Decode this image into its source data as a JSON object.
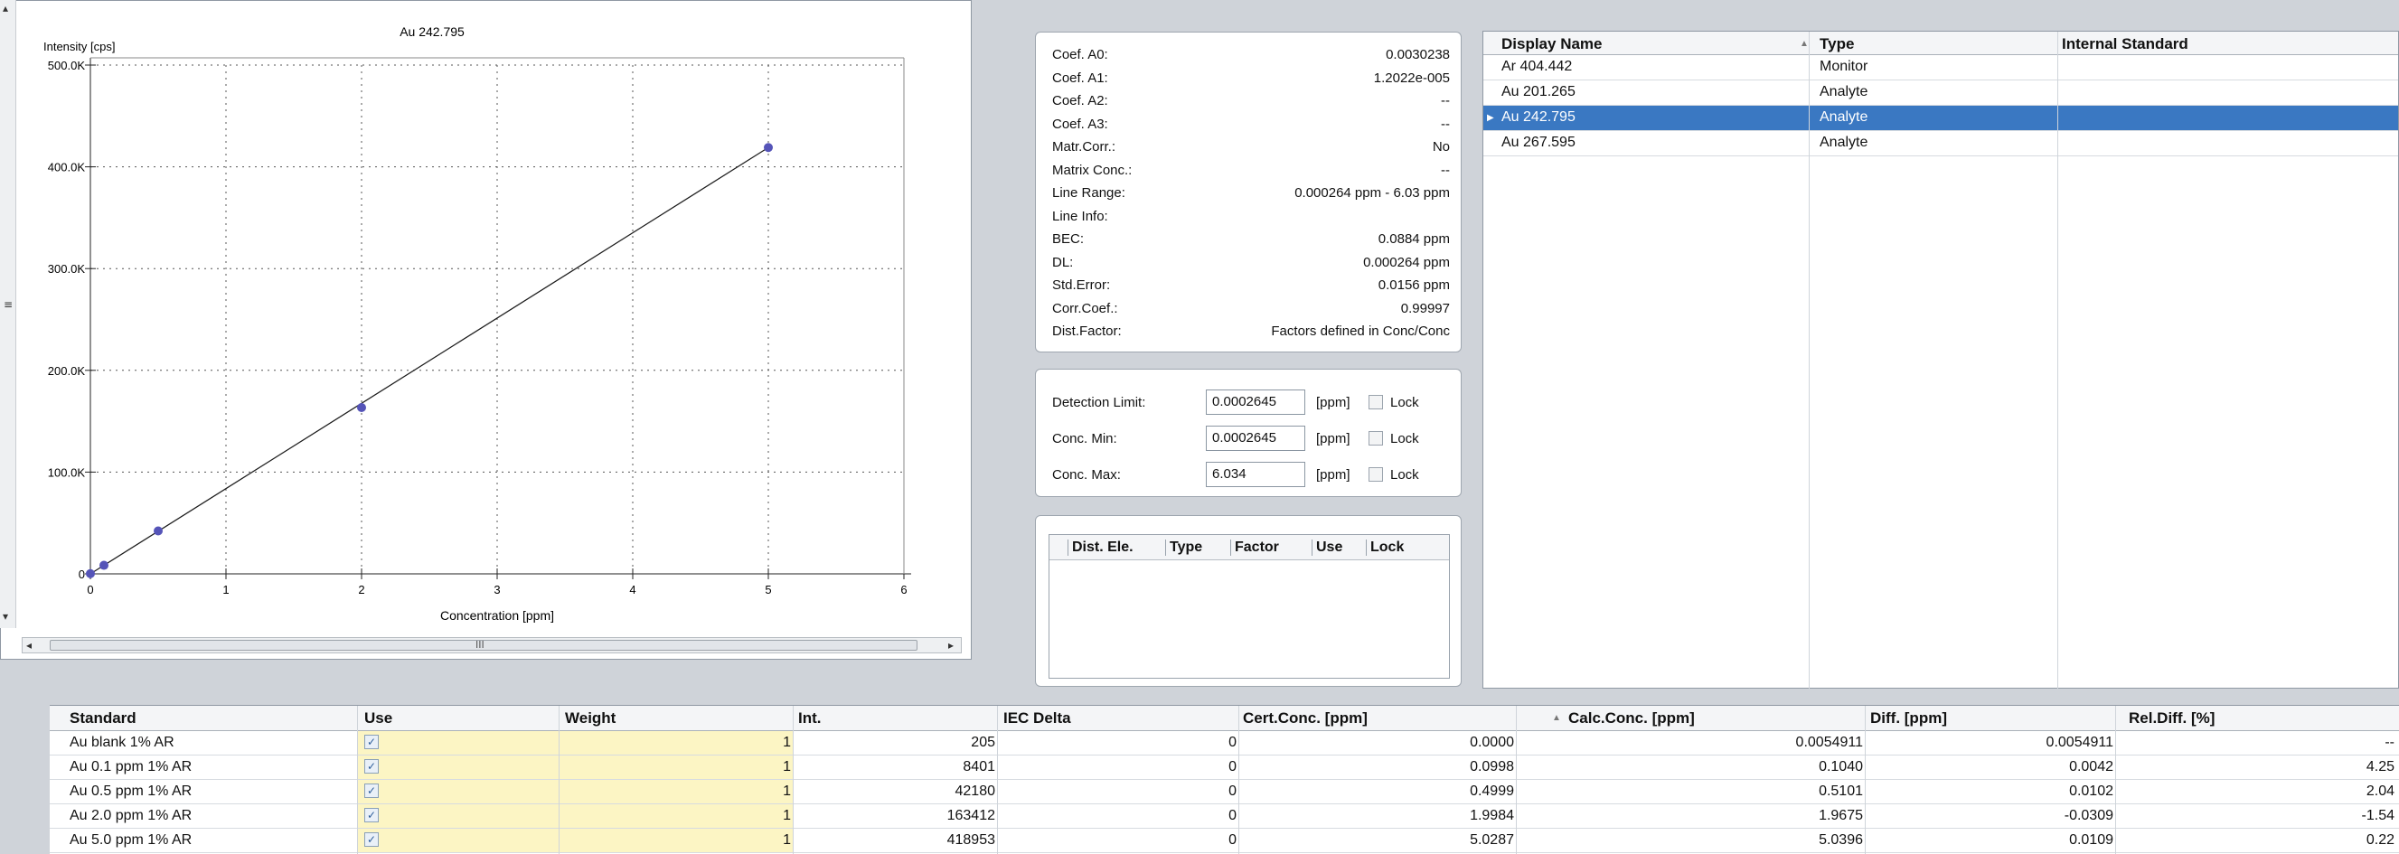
{
  "chart": {
    "title": "Au 242.795",
    "ylabel": "Intensity [cps]",
    "xlabel": "Concentration [ppm]",
    "scroll_label": "III"
  },
  "chart_data": {
    "type": "scatter",
    "title": "Au 242.795",
    "xlabel": "Concentration [ppm]",
    "ylabel": "Intensity [cps]",
    "xlim": [
      0,
      6
    ],
    "ylim": [
      0,
      500000
    ],
    "x_ticks": [
      "0",
      "1",
      "2",
      "3",
      "4",
      "5",
      "6"
    ],
    "y_ticks": [
      "0",
      "100.0K",
      "200.0K",
      "300.0K",
      "400.0K",
      "500.0K"
    ],
    "grid": true,
    "series": [
      {
        "x": [
          0,
          0.1,
          0.5,
          2.0,
          5.0
        ],
        "y": [
          205,
          8401,
          42180,
          163412,
          418953
        ]
      }
    ],
    "fit_line": {
      "x": [
        0,
        5.0
      ],
      "y": [
        0,
        418953
      ]
    }
  },
  "coef": [
    {
      "k": "Coef. A0:",
      "v": "0.0030238"
    },
    {
      "k": "Coef. A1:",
      "v": "1.2022e-005"
    },
    {
      "k": "Coef. A2:",
      "v": "--"
    },
    {
      "k": "Coef. A3:",
      "v": "--"
    },
    {
      "k": "Matr.Corr.:",
      "v": "No"
    },
    {
      "k": "Matrix Conc.:",
      "v": "--"
    },
    {
      "k": "Line Range:",
      "v": "0.000264 ppm - 6.03 ppm"
    },
    {
      "k": "Line Info:",
      "v": ""
    },
    {
      "k": "BEC:",
      "v": "0.0884 ppm"
    },
    {
      "k": "DL:",
      "v": "0.000264 ppm"
    },
    {
      "k": "Std.Error:",
      "v": "0.0156 ppm"
    },
    {
      "k": "Corr.Coef.:",
      "v": "0.99997"
    },
    {
      "k": "Dist.Factor:",
      "v": "Factors defined in Conc/Conc"
    }
  ],
  "limits": [
    {
      "k": "Detection Limit:",
      "v": "0.0002645",
      "unit": "[ppm]",
      "lock": "Lock"
    },
    {
      "k": "Conc. Min:",
      "v": "0.0002645",
      "unit": "[ppm]",
      "lock": "Lock"
    },
    {
      "k": "Conc. Max:",
      "v": "6.034",
      "unit": "[ppm]",
      "lock": "Lock"
    }
  ],
  "dist": {
    "cols": [
      "Dist. Ele.",
      "Type",
      "Factor",
      "Use",
      "Lock"
    ]
  },
  "display": {
    "cols": [
      "Display Name",
      "Type",
      "Internal Standard"
    ],
    "rows": [
      {
        "name": "Ar 404.442",
        "type": "Monitor"
      },
      {
        "name": "Au 201.265",
        "type": "Analyte"
      },
      {
        "name": "Au 242.795",
        "type": "Analyte"
      },
      {
        "name": "Au 267.595",
        "type": "Analyte"
      }
    ]
  },
  "standards": {
    "cols": [
      "Standard",
      "Use",
      "Weight",
      "Int.",
      "IEC Delta",
      "Cert.Conc. [ppm]",
      "Calc.Conc. [ppm]",
      "Diff. [ppm]",
      "Rel.Diff. [%]"
    ],
    "rows": [
      {
        "name": "Au blank 1% AR",
        "weight": "1",
        "int": "205",
        "iec": "0",
        "cert": "0.0000",
        "calc": "0.0054911",
        "diff": "0.0054911",
        "rel": "--"
      },
      {
        "name": "Au 0.1 ppm 1% AR",
        "weight": "1",
        "int": "8401",
        "iec": "0",
        "cert": "0.0998",
        "calc": "0.1040",
        "diff": "0.0042",
        "rel": "4.25"
      },
      {
        "name": "Au 0.5 ppm 1% AR",
        "weight": "1",
        "int": "42180",
        "iec": "0",
        "cert": "0.4999",
        "calc": "0.5101",
        "diff": "0.0102",
        "rel": "2.04"
      },
      {
        "name": "Au 2.0 ppm 1% AR",
        "weight": "1",
        "int": "163412",
        "iec": "0",
        "cert": "1.9984",
        "calc": "1.9675",
        "diff": "-0.0309",
        "rel": "-1.54"
      },
      {
        "name": "Au 5.0 ppm 1% AR",
        "weight": "1",
        "int": "418953",
        "iec": "0",
        "cert": "5.0287",
        "calc": "5.0396",
        "diff": "0.0109",
        "rel": "0.22"
      }
    ]
  }
}
